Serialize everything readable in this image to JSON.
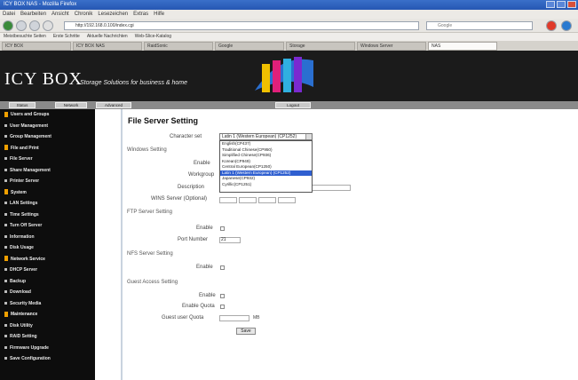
{
  "window": {
    "title": "ICY BOX NAS - Mozilla Firefox"
  },
  "menu": [
    "Datei",
    "Bearbeiten",
    "Ansicht",
    "Chronik",
    "Lesezeichen",
    "Extras",
    "Hilfe"
  ],
  "address": {
    "url": "http://192.168.0.100/index.cgi",
    "search_placeholder": "Google"
  },
  "bookmarks": [
    "Meistbesuchte Seiten",
    "Erste Schritte",
    "Aktuelle Nachrichten",
    "Web-Slice-Katalog"
  ],
  "tabs": [
    "ICY BOX",
    "ICY BOX NAS",
    "RaidSonic",
    "Google",
    "Storage",
    "Windows Server",
    "NAS"
  ],
  "banner": {
    "logo": "ICY BOX",
    "tagline": "Storage Solutions for business & home"
  },
  "topnav": [
    "Status",
    "Network",
    "Advanced",
    "Logout"
  ],
  "sidebar": [
    {
      "label": "Users and Groups",
      "head": true
    },
    {
      "label": "User Management"
    },
    {
      "label": "Group Management"
    },
    {
      "label": "File and Print",
      "head": true
    },
    {
      "label": "File Server"
    },
    {
      "label": "Share Management"
    },
    {
      "label": "Printer Server"
    },
    {
      "label": "System",
      "head": true
    },
    {
      "label": "LAN Settings"
    },
    {
      "label": "Time Settings"
    },
    {
      "label": "Turn Off Server"
    },
    {
      "label": "Information"
    },
    {
      "label": "Disk Usage"
    },
    {
      "label": "Network Service",
      "head": true
    },
    {
      "label": "DHCP Server"
    },
    {
      "label": "Backup"
    },
    {
      "label": "Download"
    },
    {
      "label": "Security Media"
    },
    {
      "label": "Maintenance",
      "head": true
    },
    {
      "label": "Disk Utility"
    },
    {
      "label": "RAID Setting"
    },
    {
      "label": "Firmware Upgrade"
    },
    {
      "label": "Save Configuration"
    }
  ],
  "page": {
    "title": "File Server Setting",
    "charset_label": "Character set",
    "charset_value": "Latin 1 (Western European) (CP1252)",
    "charset_options": [
      "English(CP437)",
      "Traditional Chinese(CP950)",
      "Simplified Chinese(CP936)",
      "Korean(CP949)",
      "Central European(CP1250)",
      "Latin 1 (Western European) (CP1252)",
      "Japanese(CP932)",
      "Cyrillic(CP1251)"
    ],
    "windows_section": "Windows Setting",
    "enable_label": "Enable",
    "workgroup_label": "Workgroup",
    "description_label": "Description",
    "wins_label": "WINS Server (Optional)",
    "ftp_section": "FTP Server Setting",
    "ftp_enable_label": "Enable",
    "port_label": "Port Number",
    "port_value": "21",
    "nfs_section": "NFS Server Setting",
    "nfs_enable_label": "Enable",
    "guest_section": "Guest Access Setting",
    "guest_enable_label": "Enable",
    "quota_enable_label": "Enable Quota",
    "quota_label": "Guest user Quota",
    "quota_unit": "MB",
    "save_label": "Save"
  }
}
